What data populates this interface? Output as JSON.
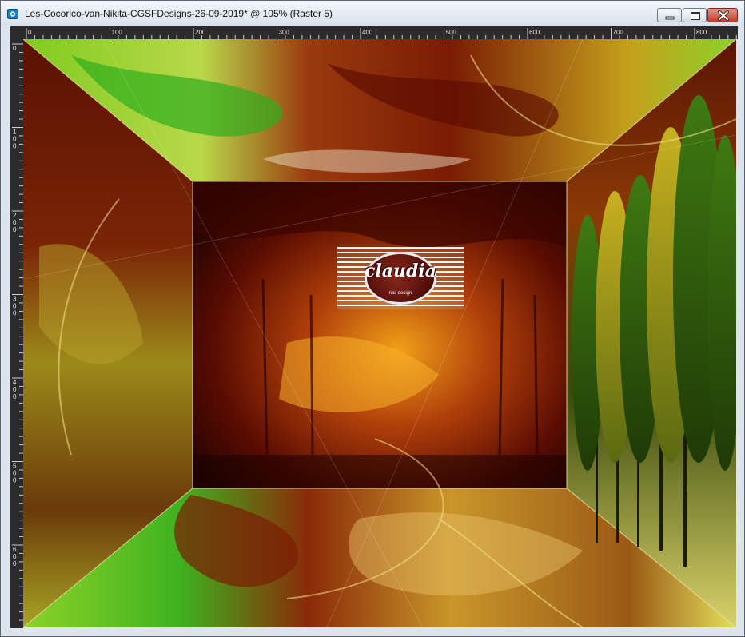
{
  "window": {
    "title": "Les-Cocorico-van-Nikita-CGSFDesigns-26-09-2019* @ 105% (Raster 5)",
    "icons": {
      "app": "psp-image-icon",
      "minimize": "minimize-icon",
      "maximize": "maximize-icon",
      "close": "close-icon"
    },
    "close_color": "#c43b28"
  },
  "ruler": {
    "top_labels": [
      "0",
      "100",
      "200",
      "300",
      "400",
      "500",
      "600",
      "700",
      "800"
    ],
    "left_labels": [
      "0",
      "100",
      "200",
      "300",
      "400",
      "500",
      "600"
    ],
    "background": "#2b2b2b"
  },
  "canvas": {
    "watermark_text": "claudia",
    "watermark_subtext": "nail design"
  }
}
